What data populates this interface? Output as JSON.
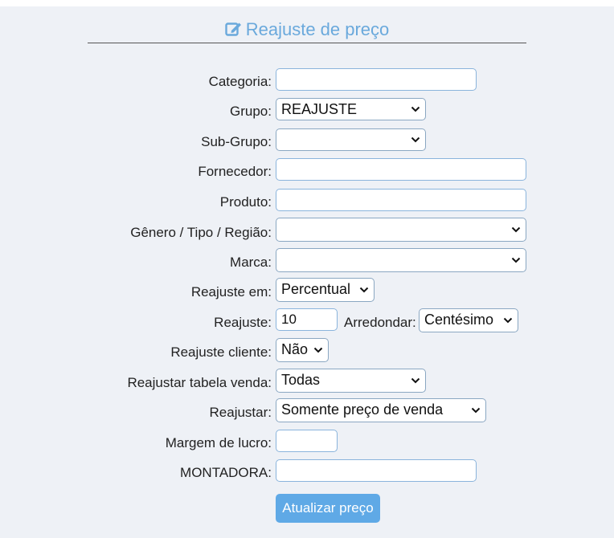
{
  "title": "Reajuste de preço",
  "fields": {
    "categoria": {
      "label": "Categoria:",
      "value": ""
    },
    "grupo": {
      "label": "Grupo:",
      "value": "REAJUSTE"
    },
    "subgrupo": {
      "label": "Sub-Grupo:",
      "value": ""
    },
    "fornecedor": {
      "label": "Fornecedor:",
      "value": ""
    },
    "produto": {
      "label": "Produto:",
      "value": ""
    },
    "genero": {
      "label": "Gênero / Tipo / Região:",
      "value": ""
    },
    "marca": {
      "label": "Marca:",
      "value": ""
    },
    "reajuste_em": {
      "label": "Reajuste em:",
      "value": "Percentual"
    },
    "reajuste": {
      "label": "Reajuste:",
      "value": "10"
    },
    "arredondar": {
      "label": "Arredondar:",
      "value": "Centésimo"
    },
    "reajuste_cliente": {
      "label": "Reajuste cliente:",
      "value": "Não"
    },
    "tabela_venda": {
      "label": "Reajustar tabela venda:",
      "value": "Todas"
    },
    "reajustar": {
      "label": "Reajustar:",
      "value": "Somente preço de venda"
    },
    "margem": {
      "label": "Margem de lucro:",
      "value": ""
    },
    "montadora": {
      "label": "MONTADORA:",
      "value": ""
    }
  },
  "submit_label": "Atualizar preço"
}
